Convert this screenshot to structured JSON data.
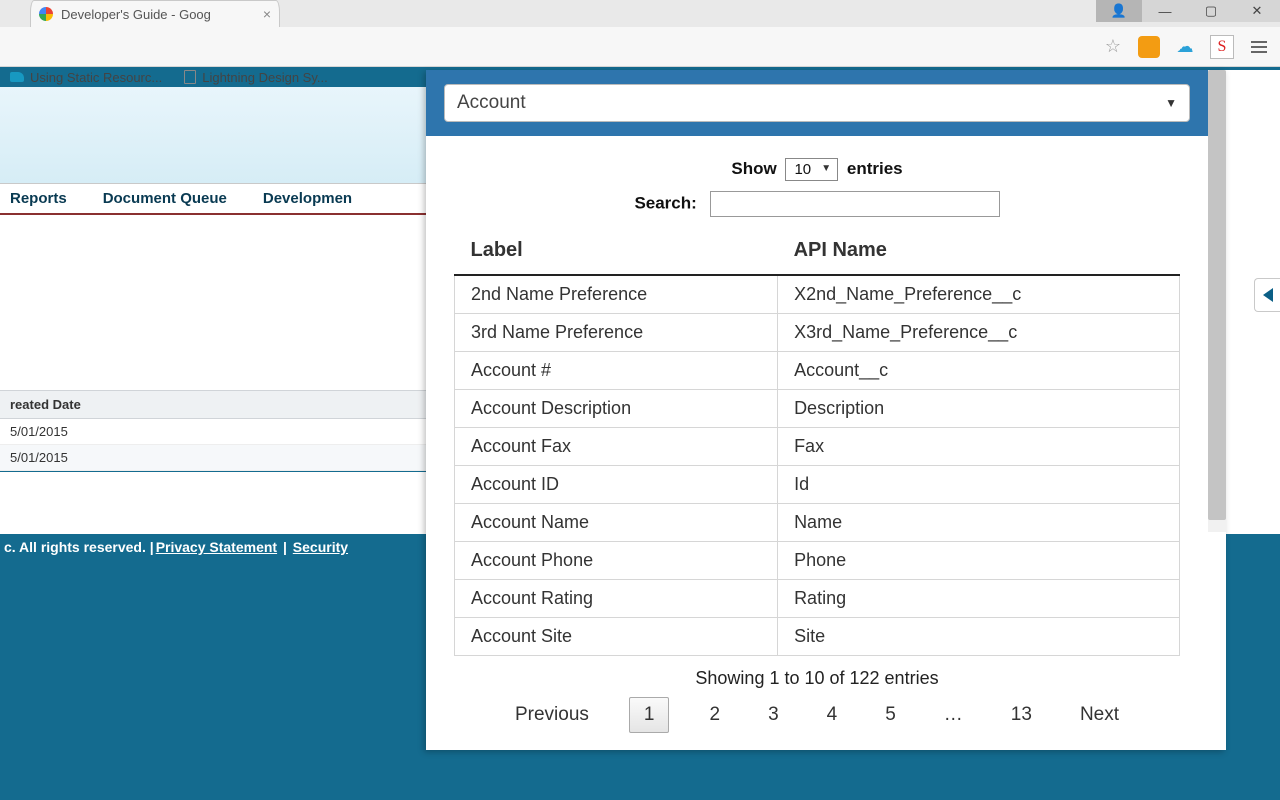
{
  "browser": {
    "tab_title": "Developer's Guide - Goog",
    "bookmarks": [
      "Using Static Resourc...",
      "Lightning Design Sy..."
    ]
  },
  "background_page": {
    "nav": [
      "Reports",
      "Document Queue",
      "Developmen"
    ],
    "table_header": "reated Date",
    "table_rows": [
      "5/01/2015",
      "5/01/2015"
    ],
    "footer_prefix": "c. All rights reserved. | ",
    "footer_links": [
      "Privacy Statement",
      "Security"
    ]
  },
  "popup": {
    "object_selected": "Account",
    "show_label_pre": "Show",
    "show_value": "10",
    "show_label_post": "entries",
    "search_label": "Search:",
    "search_value": "",
    "columns": [
      "Label",
      "API Name"
    ],
    "rows": [
      {
        "label": "2nd Name Preference",
        "api": "X2nd_Name_Preference__c"
      },
      {
        "label": "3rd Name Preference",
        "api": "X3rd_Name_Preference__c"
      },
      {
        "label": "Account #",
        "api": "Account__c"
      },
      {
        "label": "Account Description",
        "api": "Description"
      },
      {
        "label": "Account Fax",
        "api": "Fax"
      },
      {
        "label": "Account ID",
        "api": "Id"
      },
      {
        "label": "Account Name",
        "api": "Name"
      },
      {
        "label": "Account Phone",
        "api": "Phone"
      },
      {
        "label": "Account Rating",
        "api": "Rating"
      },
      {
        "label": "Account Site",
        "api": "Site"
      }
    ],
    "info": "Showing 1 to 10 of 122 entries",
    "pager": {
      "prev": "Previous",
      "pages": [
        "1",
        "2",
        "3",
        "4",
        "5",
        "…",
        "13"
      ],
      "current": "1",
      "next": "Next"
    }
  }
}
